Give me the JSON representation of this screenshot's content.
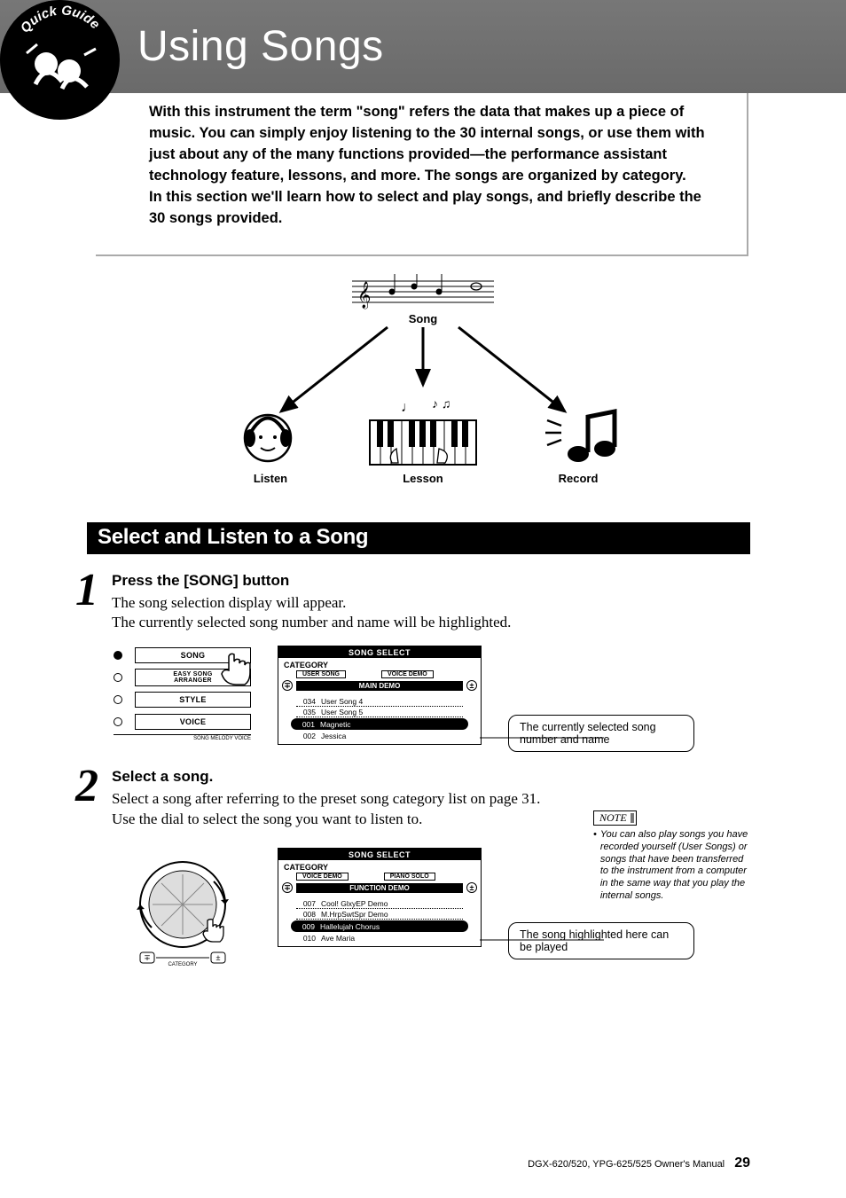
{
  "header": {
    "badge_label": "Quick Guide",
    "title": "Using Songs"
  },
  "intro": {
    "p1": "With this instrument the term \"song\" refers the data that makes up a piece of music. You can simply enjoy listening to the 30 internal songs, or use them with just about any of the many functions provided—the performance assistant technology feature, lessons, and more. The songs are organized by category.",
    "p2": "In this section we'll learn how to select and play songs, and briefly describe the 30 songs provided."
  },
  "diagram": {
    "song": "Song",
    "listen": "Listen",
    "lesson": "Lesson",
    "record": "Record"
  },
  "section": {
    "title": "Select and Listen to a Song"
  },
  "step1": {
    "num": "1",
    "title": "Press the [SONG] button",
    "line1": "The song selection display will appear.",
    "line2": "The currently selected song number and name will be highlighted.",
    "panel": {
      "song": "SONG",
      "easy": "EASY SONG\nARRANGER",
      "style": "STYLE",
      "voice": "VOICE",
      "melody": "SONG MELODY VOICE"
    },
    "lcd": {
      "title": "SONG SELECT",
      "category": "CATEGORY",
      "tab_l": "USER SONG",
      "tab_r": "VOICE DEMO",
      "bar": "MAIN DEMO",
      "rows": [
        {
          "n": "034",
          "t": "User Song 4"
        },
        {
          "n": "035",
          "t": "User Song 5"
        },
        {
          "n": "001",
          "t": "Magnetic"
        },
        {
          "n": "002",
          "t": "Jessica"
        }
      ],
      "sel_index": 2
    },
    "callout": "The currently selected song number and name"
  },
  "step2": {
    "num": "2",
    "title": "Select a song.",
    "line1": "Select a song after referring to the preset song category list on page 31.",
    "line2": "Use the dial to select the song you want to listen to.",
    "dial_label": "CATEGORY",
    "lcd": {
      "title": "SONG SELECT",
      "category": "CATEGORY",
      "tab_l": "VOICE DEMO",
      "tab_r": "PIANO SOLO",
      "bar": "FUNCTION DEMO",
      "rows": [
        {
          "n": "007",
          "t": "Cool! GlxyEP Demo"
        },
        {
          "n": "008",
          "t": "M.HrpSwtSpr Demo"
        },
        {
          "n": "009",
          "t": "Hallelujah Chorus"
        },
        {
          "n": "010",
          "t": "Ave Maria"
        }
      ],
      "sel_index": 2
    },
    "callout": "The song highlighted here can be played"
  },
  "note": {
    "label": "NOTE",
    "text": "You can also play songs you have recorded yourself (User Songs) or songs that have been transferred to the instrument from a computer in the same way that you play the internal songs."
  },
  "footer": {
    "text": "DGX-620/520, YPG-625/525  Owner's Manual",
    "page": "29"
  }
}
